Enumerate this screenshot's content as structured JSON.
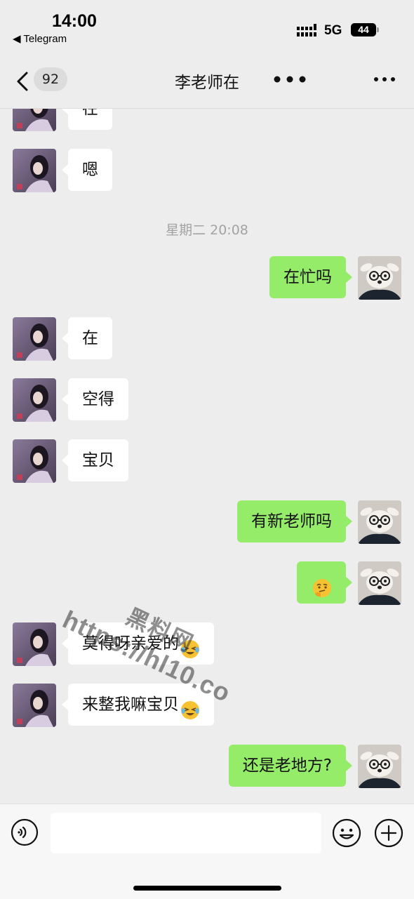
{
  "status": {
    "time": "14:00",
    "back_app": "◀ Telegram",
    "network": "5G",
    "battery": "44"
  },
  "nav": {
    "unread": "92",
    "title": "李老师在"
  },
  "chat": {
    "timestamp": "星期二 20:08",
    "messages": [
      {
        "side": "in",
        "text": "在"
      },
      {
        "side": "in",
        "text": "嗯"
      },
      {
        "side": "out",
        "text": "在忙吗"
      },
      {
        "side": "in",
        "text": "在"
      },
      {
        "side": "in",
        "text": "空得"
      },
      {
        "side": "in",
        "text": "宝贝"
      },
      {
        "side": "out",
        "text": "有新老师吗"
      },
      {
        "side": "out",
        "text": "",
        "emoji": "thinking-face"
      },
      {
        "side": "in",
        "text": "莫得呀亲爱的",
        "emoji": "laughing-crying-face"
      },
      {
        "side": "in",
        "text": "来整我嘛宝贝",
        "emoji": "laughing-crying-face"
      },
      {
        "side": "out",
        "text": "还是老地方?"
      }
    ]
  },
  "watermark": {
    "line1": "黑料网",
    "line2": "https://hl10.co"
  },
  "input": {
    "placeholder": ""
  },
  "colors": {
    "outgoing_bubble": "#95ec69",
    "incoming_bubble": "#ffffff",
    "background": "#ededed"
  }
}
